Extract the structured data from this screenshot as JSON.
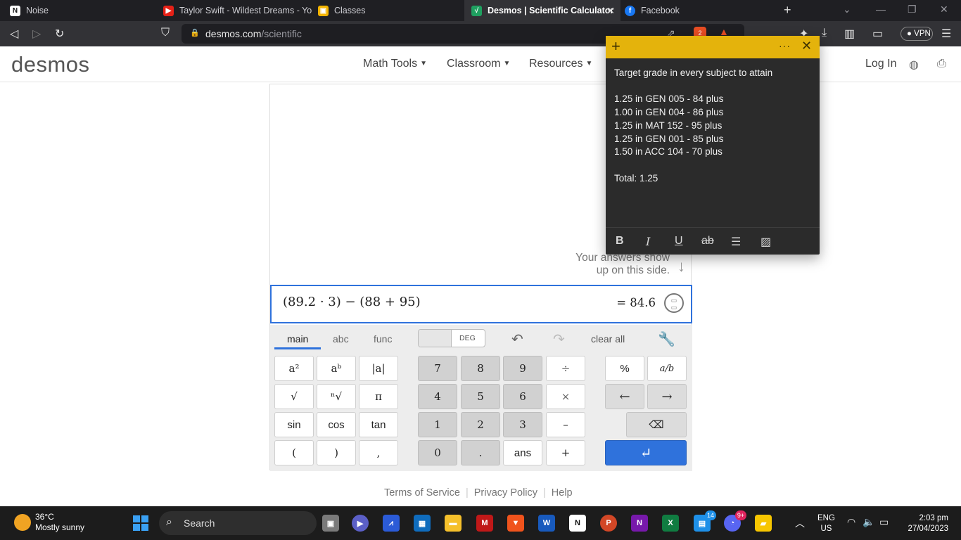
{
  "browser": {
    "tabs": [
      {
        "title": "Noise",
        "active": false,
        "icon": "notion-icon"
      },
      {
        "title": "Taylor Swift - Wildest Dreams - You",
        "active": false,
        "icon": "youtube-icon"
      },
      {
        "title": "Classes",
        "active": false,
        "icon": "classroom-icon"
      },
      {
        "title": "Desmos | Scientific Calculator",
        "active": true,
        "icon": "desmos-icon"
      },
      {
        "title": "Facebook",
        "active": false,
        "icon": "facebook-icon"
      }
    ],
    "url_host": "desmos.com",
    "url_path": "/scientific",
    "vpn_label": "VPN",
    "shield_badge": "2"
  },
  "site": {
    "logo": "desmos",
    "menu": [
      "Math Tools",
      "Classroom",
      "Resources"
    ],
    "login": "Log In"
  },
  "calculator": {
    "hint_line1": "Your answers show",
    "hint_line2": "up on this side.",
    "expression": "(89.2 · 3) − (88 + 95)",
    "result": "= 84.6",
    "tabs": [
      "main",
      "abc",
      "func"
    ],
    "active_tab": "main",
    "angle_mode": "DEG",
    "clear_all": "clear all",
    "func_keys": [
      "a²",
      "aᵇ",
      "|a|",
      "√",
      "ⁿ√",
      "π",
      "sin",
      "cos",
      "tan",
      "(",
      ")",
      ","
    ],
    "num_keys": [
      "7",
      "8",
      "9",
      "4",
      "5",
      "6",
      "1",
      "2",
      "3",
      "0",
      ".",
      "ans"
    ],
    "op_keys": [
      "÷",
      "×",
      "–",
      "+"
    ],
    "extra_keys": [
      "%",
      "a/b",
      "←",
      "→"
    ]
  },
  "footer": {
    "links": [
      "Terms of Service",
      "Privacy Policy",
      "Help"
    ]
  },
  "sticky_note": {
    "heading": "Target grade in every subject to attain",
    "lines": [
      "1.25 in GEN 005 - 84 plus",
      "1.00 in GEN 004 - 86 plus",
      "1.25 in MAT 152 - 95 plus",
      "1.25 in GEN 001 - 85 plus",
      "1.50 in ACC 104 - 70 plus"
    ],
    "total": "Total: 1.25",
    "tools": [
      "B",
      "I",
      "U",
      "ab"
    ]
  },
  "taskbar": {
    "weather_temp": "36°C",
    "weather_desc": "Mostly sunny",
    "search_label": "Search",
    "lang1": "ENG",
    "lang2": "US",
    "time": "2:03 pm",
    "date": "27/04/2023",
    "badge_teams": "14",
    "badge_discord": "9+"
  }
}
